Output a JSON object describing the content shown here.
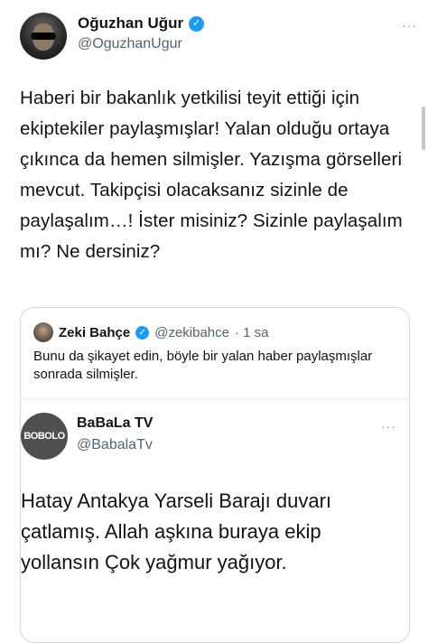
{
  "main_tweet": {
    "author_name": "Oğuzhan Uğur",
    "author_handle": "@OguzhanUgur",
    "text": "Haberi bir bakanlık yetkilisi teyit ettiği için ekiptekiler paylaşmışlar! Yalan olduğu ortaya çıkınca da hemen silmişler. Yazışma görselleri mevcut. Takipçisi olacaksanız sizinle de paylaşalım…! İster misiniz? Sizinle paylaşalım mı? Ne dersiniz?",
    "more_glyph": "···"
  },
  "quoted_tweet": {
    "author_name": "Zeki Bahçe",
    "author_handle": "@zekibahce",
    "time": "· 1 sa",
    "text": "Bunu da şikayet edin, böyle bir yalan haber paylaşmışlar sonrada silmişler."
  },
  "embedded_tweet": {
    "avatar_text": "BOBOLO",
    "author_name": "BaBaLa TV",
    "author_handle": "@BabalaTv",
    "more_glyph": "···",
    "text": "Hatay Antakya Yarseli Barajı duvarı çatlamış. Allah aşkına buraya ekip yollansın Çok yağmur yağıyor."
  },
  "icons": {
    "verified": "verified-badge-icon",
    "more": "more-options-icon"
  },
  "colors": {
    "verified": "#1d9bf0",
    "secondary_text": "#536471",
    "border": "#cfd9de"
  }
}
